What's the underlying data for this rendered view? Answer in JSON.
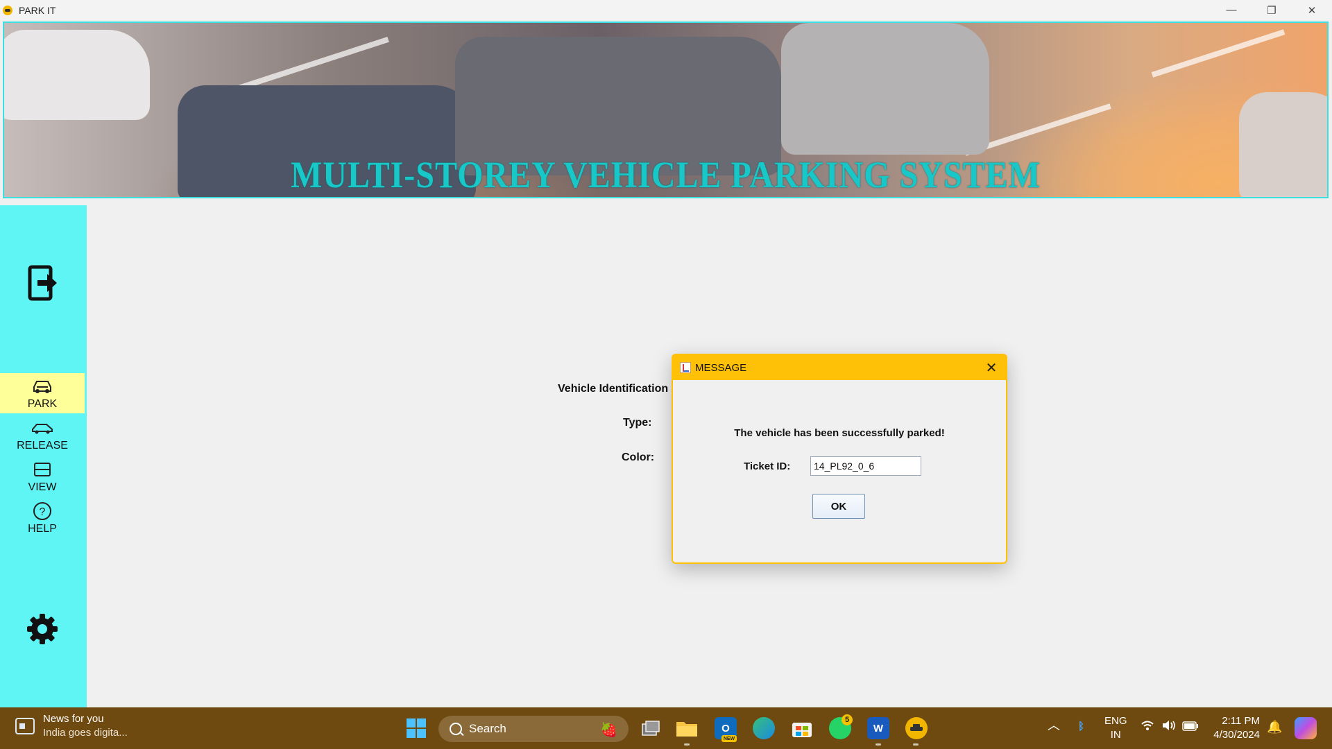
{
  "window": {
    "title": "PARK IT",
    "minimize": "—",
    "maximize": "❐",
    "close": "✕"
  },
  "banner": {
    "title": "MULTI-STOREY VEHICLE PARKING SYSTEM"
  },
  "sidebar": {
    "items": [
      {
        "label": "PARK",
        "icon": "car-icon",
        "active": true
      },
      {
        "label": "RELEASE",
        "icon": "car-icon"
      },
      {
        "label": "VIEW",
        "icon": "view-list-icon"
      },
      {
        "label": "HELP",
        "icon": "help-circle-icon"
      }
    ]
  },
  "form": {
    "vin_label": "Vehicle Identification N",
    "type_label": "Type:",
    "color_label": "Color:"
  },
  "dialog": {
    "title": "MESSAGE",
    "message": "The vehicle has been successfully parked!",
    "ticket_label": "Ticket ID:",
    "ticket_value": "14_PL92_0_6",
    "ok_label": "OK",
    "close": "✕"
  },
  "taskbar": {
    "news_title": "News for you",
    "news_sub": "India goes digita...",
    "search_label": "Search",
    "whatsapp_badge": "5",
    "outlook_tag": "NEW",
    "lang_line1": "ENG",
    "lang_line2": "IN",
    "time": "2:11 PM",
    "date": "4/30/2024"
  },
  "colors": {
    "sidebar": "#5ff5f5",
    "active_item": "#ffff99",
    "banner_title": "#18c8c8",
    "dialog_accent": "#ffc107",
    "taskbar": "#6f4a10"
  }
}
